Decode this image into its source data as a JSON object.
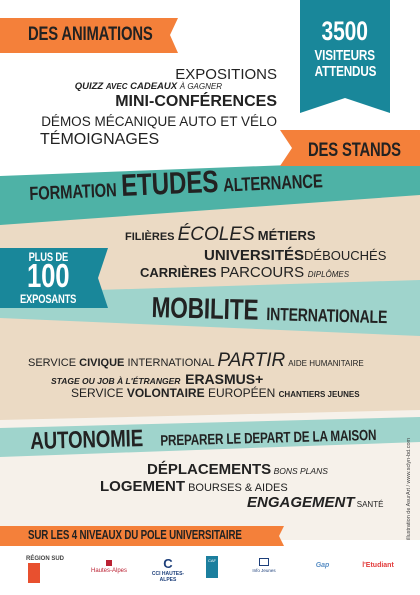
{
  "animations": {
    "title": "DES ANIMATIONS",
    "lines": [
      [
        "EXPOSITIONS"
      ],
      [
        "QUIZZ",
        "AVEC",
        "CADEAUX",
        "À GAGNER"
      ],
      [
        "MINI-CONFÉRENCES"
      ],
      [
        "DÉMOS MÉCANIQUE AUTO ET VÉLO"
      ],
      [
        "TÉMOIGNAGES"
      ]
    ]
  },
  "visitors": {
    "number": "3500",
    "line1": "VISITEURS",
    "line2": "ATTENDUS"
  },
  "stands": {
    "title": "DES STANDS"
  },
  "formation": {
    "band": [
      "FORMATION",
      "ETUDES",
      "ALTERNANCE"
    ],
    "words": [
      [
        "FILIÈRES",
        "ÉCOLES",
        "MÉTIERS"
      ],
      [
        "UNIVERSITÉS",
        "DÉBOUCHÉS"
      ],
      [
        "CARRIÈRES",
        "PARCOURS",
        "DIPLÔMES"
      ]
    ]
  },
  "exhibitors": {
    "line1": "PLUS DE",
    "number": "100",
    "line2": "EXPOSANTS"
  },
  "mobilite": {
    "band": [
      "MOBILITE",
      "INTERNATIONALE"
    ],
    "words": [
      [
        "SERVICE",
        "CIVIQUE",
        "INTERNATIONAL",
        "PARTIR",
        "AIDE HUMANITAIRE"
      ],
      [
        "STAGE OU JOB À L'ÉTRANGER",
        "ERASMUS+"
      ],
      [
        "SERVICE",
        "VOLONTAIRE",
        "EUROPÉEN",
        "CHANTIERS JEUNES"
      ]
    ]
  },
  "autonomie": {
    "band": [
      "AUTONOMIE",
      "PREPARER LE DEPART DE LA MAISON"
    ],
    "words": [
      [
        "DÉPLACEMENTS",
        "BONS PLANS"
      ],
      [
        "LOGEMENT",
        "BOURSES & AIDES"
      ],
      [
        "ENGAGEMENT",
        "SANTÉ"
      ]
    ]
  },
  "footer": {
    "banner": "SUR LES 4 NIVEAUX DU POLE UNIVERSITAIRE",
    "logos": [
      "RÉGION SUD",
      "Hautes-Alpes",
      "CCI HAUTES-ALPES",
      "CAF",
      "Info Jeunes",
      "Gap",
      "l'Etudiant"
    ]
  },
  "credit": "illustration de AsurArt / www.sclyn-bd.com",
  "colors": {
    "orange": "#f4803a",
    "teal_dark": "#19879a",
    "teal": "#4eb2a6",
    "teal_light": "#9fd4cc",
    "beige": "#ebdac4",
    "cream": "#f6f1ea"
  }
}
